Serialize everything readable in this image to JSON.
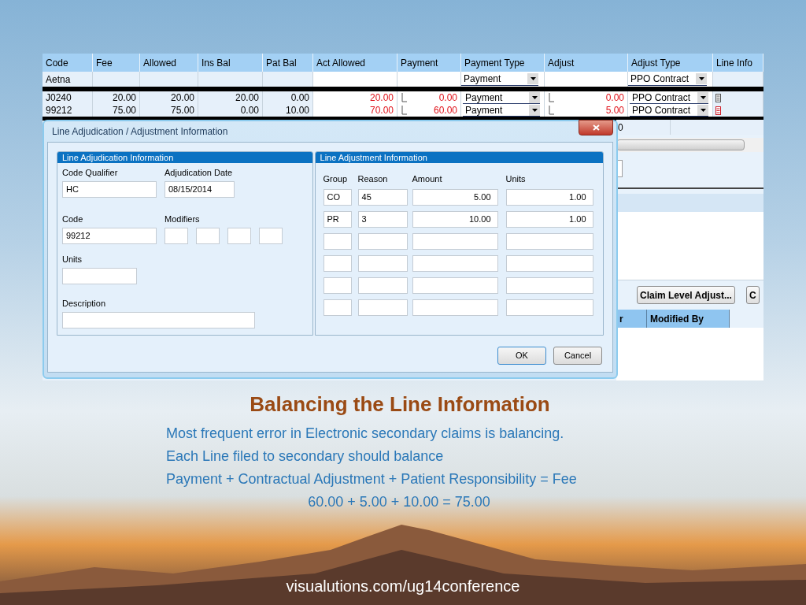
{
  "grid": {
    "columns": [
      "Code",
      "Fee",
      "Allowed",
      "Ins Bal",
      "Pat Bal",
      "Act Allowed",
      "Payment",
      "Payment Type",
      "Adjust",
      "Adjust Type",
      "Line Info"
    ],
    "payer_row": {
      "code": "Aetna",
      "payment_type": "Payment",
      "adjust_type": "PPO Contract"
    },
    "rows": [
      {
        "code": "J0240",
        "fee": "20.00",
        "allowed": "20.00",
        "ins_bal": "20.00",
        "pat_bal": "0.00",
        "act_allowed": "20.00",
        "payment_checked": false,
        "payment": "0.00",
        "payment_type": "Payment",
        "adjust_checked": false,
        "adjust": "0.00",
        "adjust_type": "PPO Contract",
        "line_info_flagged": false
      },
      {
        "code": "99212",
        "fee": "75.00",
        "allowed": "75.00",
        "ins_bal": "0.00",
        "pat_bal": "10.00",
        "act_allowed": "70.00",
        "payment_checked": false,
        "payment": "60.00",
        "payment_type": "Payment",
        "adjust_checked": false,
        "adjust": "5.00",
        "adjust_type": "PPO Contract",
        "line_info_flagged": true
      }
    ]
  },
  "background_window": {
    "cell": "0",
    "buttons": [
      "Claim Level Adjust...",
      "C"
    ],
    "columns": [
      "r",
      "Modified By"
    ]
  },
  "dialog": {
    "title": "Line Adjudication / Adjustment Information",
    "left_group": {
      "title": "Line Adjudication Information",
      "code_qualifier": {
        "label": "Code Qualifier",
        "value": "HC"
      },
      "adjudication_date": {
        "label": "Adjudication Date",
        "value": "08/15/2014"
      },
      "code": {
        "label": "Code",
        "value": "99212"
      },
      "modifiers": {
        "label": "Modifiers"
      },
      "units": {
        "label": "Units"
      },
      "description": {
        "label": "Description"
      }
    },
    "right_group": {
      "title": "Line Adjustment Information",
      "columns": [
        "Group",
        "Reason",
        "Amount",
        "Units"
      ],
      "rows": [
        {
          "group": "CO",
          "reason": "45",
          "amount": "5.00",
          "units": "1.00"
        },
        {
          "group": "PR",
          "reason": "3",
          "amount": "10.00",
          "units": "1.00"
        },
        {},
        {},
        {},
        {}
      ]
    },
    "buttons": [
      "OK",
      "Cancel"
    ]
  },
  "slide": {
    "title": "Balancing the Line Information",
    "lines": [
      "Most frequent error in Electronic secondary claims is balancing.",
      "Each Line filed to secondary should balance",
      "Payment + Contractual Adjustment + Patient Responsibility = Fee"
    ],
    "equation": "60.00 + 5.00 + 10.00 = 75.00",
    "footer": "visualutions.com/ug14conference"
  }
}
